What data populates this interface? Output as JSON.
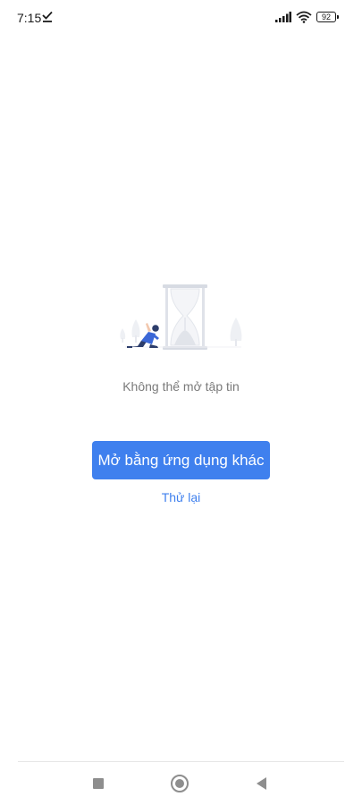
{
  "status_bar": {
    "time": "7:15",
    "battery": "92"
  },
  "main": {
    "message": "Không thể mở tập tin",
    "open_with_label": "Mở bằng ứng dụng khác",
    "retry_label": "Thử lại"
  },
  "colors": {
    "accent": "#3f80ee",
    "message_text": "#7a7a7a",
    "nav_icon": "#8e8e8e"
  },
  "icons": {
    "status": [
      "download-done-icon",
      "signal-icon",
      "wifi-icon",
      "battery-icon"
    ],
    "illustration": "hourglass-waiting-illustration",
    "nav": [
      "recents-icon",
      "home-icon",
      "back-icon"
    ]
  }
}
